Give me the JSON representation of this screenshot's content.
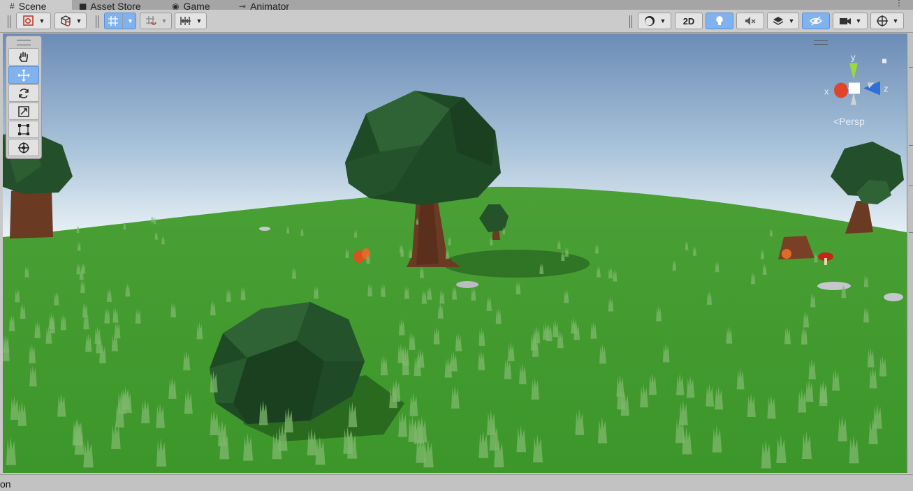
{
  "tabs": [
    {
      "label": "Scene",
      "icon": "grid-hash-icon",
      "active": true
    },
    {
      "label": "Asset Store",
      "icon": "bag-icon",
      "active": false
    },
    {
      "label": "Game",
      "icon": "gamepad-icon",
      "active": false
    },
    {
      "label": "Animator",
      "icon": "animator-icon",
      "active": false
    }
  ],
  "toolbar": {
    "two_d_label": "2D",
    "buttons": [
      "shading-mode",
      "draw-mode",
      "grid-snap",
      "increment-snap",
      "align-tools",
      "render-mode-sphere",
      "2d-toggle",
      "lighting-toggle",
      "audio-toggle",
      "effects-layers",
      "hidden-objects-toggle",
      "camera-settings",
      "gizmos"
    ]
  },
  "tool_palette": {
    "tools": [
      "hand-tool",
      "move-tool",
      "rotate-tool",
      "scale-tool",
      "rect-tool",
      "transform-tool"
    ],
    "active_tool": "move-tool"
  },
  "gizmo": {
    "x_label": "x",
    "y_label": "y",
    "z_label": "z",
    "projection_label": "Persp"
  },
  "status": {
    "text": "on"
  },
  "colors": {
    "sky_top": "#6b8cb6",
    "sky_horizon": "#e8f2f8",
    "grass": "#3f9a2e",
    "tree_foliage": "#23502a",
    "trunk": "#6b3a22",
    "accent_blue": "#7fb2ef",
    "axis_x": "#e0442c",
    "axis_y": "#9ad83c",
    "axis_z": "#2f6fd8"
  }
}
